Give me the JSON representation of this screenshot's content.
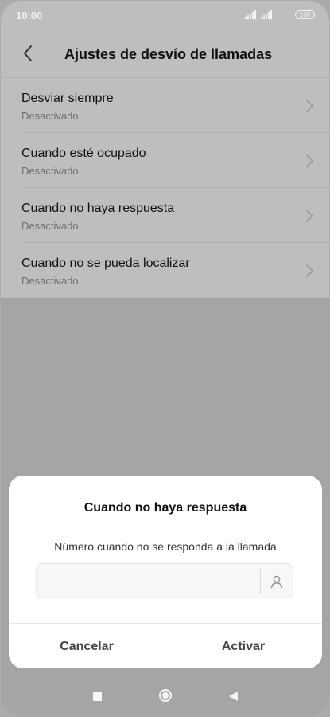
{
  "status_bar": {
    "time": "10:00",
    "battery": "100",
    "icons": [
      "signal-icon",
      "signal-icon",
      "battery-icon"
    ]
  },
  "header": {
    "title": "Ajustes de desvío de llamadas",
    "back_icon": "chevron-left-icon"
  },
  "forwarding_options": [
    {
      "title": "Desviar siempre",
      "status": "Desactivado"
    },
    {
      "title": "Cuando esté ocupado",
      "status": "Desactivado"
    },
    {
      "title": "Cuando no haya respuesta",
      "status": "Desactivado"
    },
    {
      "title": "Cuando no se pueda localizar",
      "status": "Desactivado"
    }
  ],
  "dialog": {
    "title": "Cuando no haya respuesta",
    "label": "Número cuando no se responda a la llamada",
    "input_value": "",
    "contact_icon": "person-icon",
    "cancel_label": "Cancelar",
    "confirm_label": "Activar"
  },
  "nav_bar": {
    "icons": [
      "recents-square-icon",
      "home-circle-icon",
      "back-triangle-icon"
    ]
  },
  "colors": {
    "scrim": "#bebebe",
    "dialog_bg": "#ffffff",
    "primary_text": "#111111",
    "secondary_text": "#6f6f6f"
  }
}
